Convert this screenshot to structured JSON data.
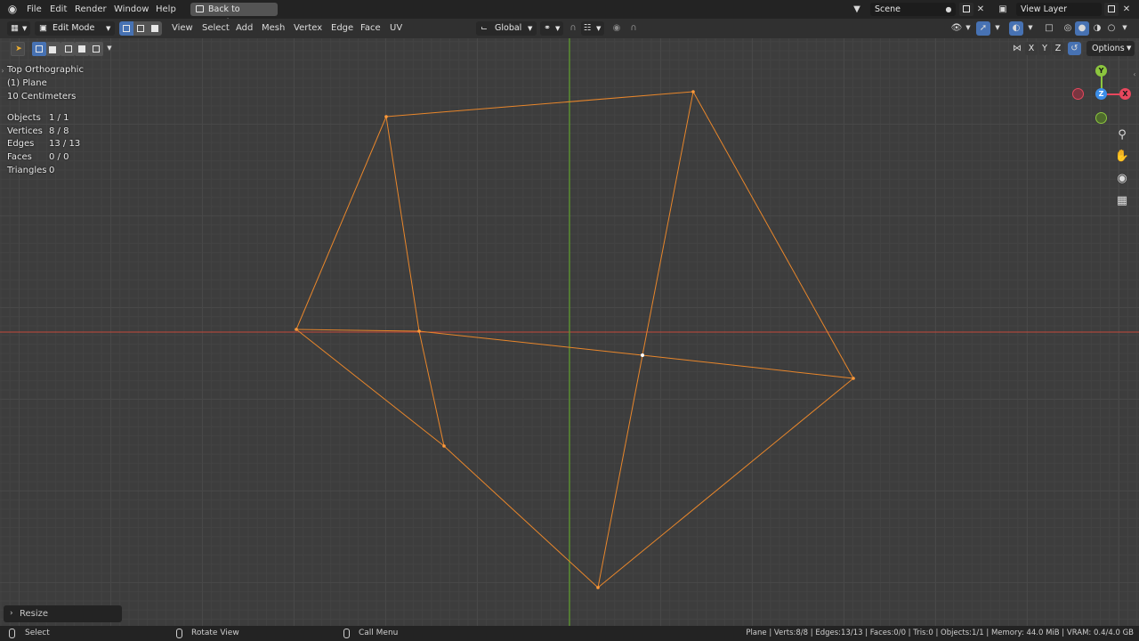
{
  "menubar": {
    "items": [
      "File",
      "Edit",
      "Render",
      "Window",
      "Help"
    ],
    "back_button": "Back to Previous",
    "scene_name": "Scene",
    "view_layer": "View Layer"
  },
  "header": {
    "mode": "Edit Mode",
    "menus": [
      "View",
      "Select",
      "Add",
      "Mesh",
      "Vertex",
      "Edge",
      "Face",
      "UV"
    ],
    "transform_orientation": "Global",
    "options_label": "Options",
    "axis_toggles": [
      "X",
      "Y",
      "Z"
    ]
  },
  "viewport_info": {
    "view_name": "Top Orthographic",
    "object_name": "(1) Plane",
    "scale": "10 Centimeters",
    "stats": [
      {
        "label": "Objects",
        "value": "1 / 1"
      },
      {
        "label": "Vertices",
        "value": "8 / 8"
      },
      {
        "label": "Edges",
        "value": "13 / 13"
      },
      {
        "label": "Faces",
        "value": "0 / 0"
      },
      {
        "label": "Triangles",
        "value": "0"
      }
    ]
  },
  "gizmo": {
    "x": "X",
    "y": "Y",
    "z": "Z"
  },
  "last_operator": "Resize",
  "statusbar": {
    "select": "Select",
    "rotate_view": "Rotate View",
    "call_menu": "Call Menu",
    "info": "Plane | Verts:8/8 | Edges:13/13 | Faces:0/0 | Tris:0 | Objects:1/1 | Memory: 44.0 MiB | VRAM: 0.4/4.0 GB"
  },
  "colors": {
    "mesh_edge": "#e8862b",
    "x_axis": "#c4493a",
    "y_axis": "#5d9e2a",
    "active_blue": "#4772b3",
    "gizmo_x": "#e8475d",
    "gizmo_y": "#8cc63e",
    "gizmo_z": "#3c8ee8"
  }
}
